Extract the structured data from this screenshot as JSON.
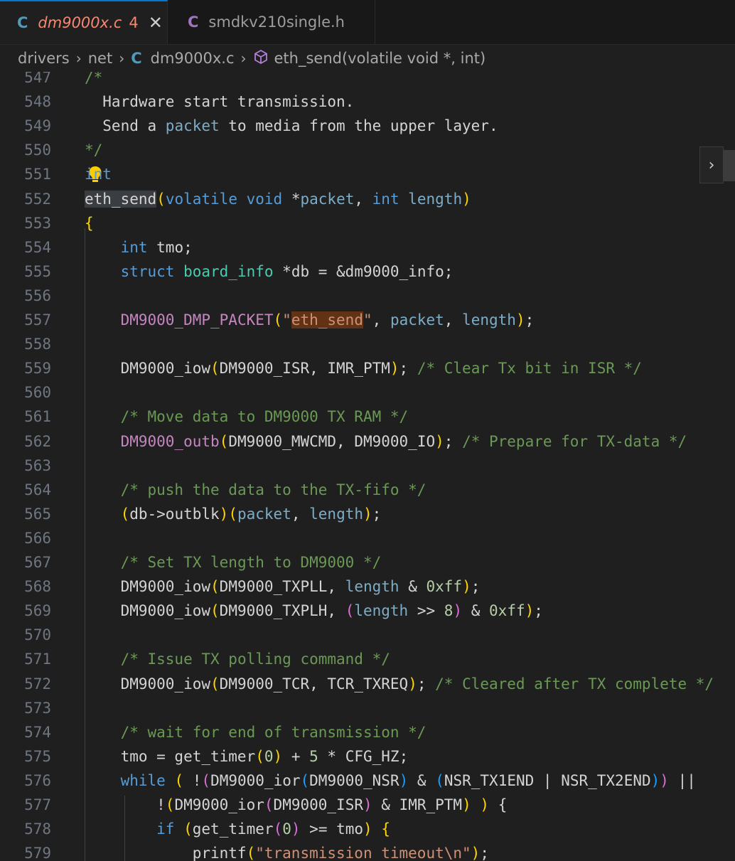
{
  "tabs": [
    {
      "icon": "C",
      "title": "dm9000x.c",
      "badge": "4",
      "close": "✕",
      "active": true
    },
    {
      "icon": "C",
      "title": "smdkv210single.h",
      "active": false
    }
  ],
  "breadcrumb": {
    "items": [
      "drivers",
      "net",
      "dm9000x.c",
      "eth_send(volatile void *, int)"
    ],
    "file_icon": "C",
    "symbol_icon": "cube-icon"
  },
  "editor": {
    "line_numbers": [
      "547",
      "548",
      "549",
      "550",
      "551",
      "552",
      "553",
      "554",
      "555",
      "556",
      "557",
      "558",
      "559",
      "560",
      "561",
      "562",
      "563",
      "564",
      "565",
      "566",
      "567",
      "568",
      "569",
      "570",
      "571",
      "572",
      "573",
      "574",
      "575",
      "576",
      "577",
      "578",
      "579"
    ],
    "lines": [
      {
        "text": "/*"
      },
      {
        "text": "  Hardware start transmission."
      },
      {
        "text": "  Send a packet to media from the upper layer."
      },
      {
        "text": "*/"
      },
      {
        "text": "int"
      },
      {
        "text": "eth_send(volatile void *packet, int length)"
      },
      {
        "text": "{"
      },
      {
        "text": "    int tmo;"
      },
      {
        "text": "    struct board_info *db = &dm9000_info;"
      },
      {
        "text": ""
      },
      {
        "text": "    DM9000_DMP_PACKET(\"eth_send\", packet, length);"
      },
      {
        "text": ""
      },
      {
        "text": "    DM9000_iow(DM9000_ISR, IMR_PTM); /* Clear Tx bit in ISR */"
      },
      {
        "text": ""
      },
      {
        "text": "    /* Move data to DM9000 TX RAM */"
      },
      {
        "text": "    DM9000_outb(DM9000_MWCMD, DM9000_IO); /* Prepare for TX-data */"
      },
      {
        "text": ""
      },
      {
        "text": "    /* push the data to the TX-fifo */"
      },
      {
        "text": "    (db->outblk)(packet, length);"
      },
      {
        "text": ""
      },
      {
        "text": "    /* Set TX length to DM9000 */"
      },
      {
        "text": "    DM9000_iow(DM9000_TXPLL, length & 0xff);"
      },
      {
        "text": "    DM9000_iow(DM9000_TXPLH, (length >> 8) & 0xff);"
      },
      {
        "text": ""
      },
      {
        "text": "    /* Issue TX polling command */"
      },
      {
        "text": "    DM9000_iow(DM9000_TCR, TCR_TXREQ); /* Cleared after TX complete */"
      },
      {
        "text": ""
      },
      {
        "text": "    /* wait for end of transmission */"
      },
      {
        "text": "    tmo = get_timer(0) + 5 * CFG_HZ;"
      },
      {
        "text": "    while ( !(DM9000_ior(DM9000_NSR) & (NSR_TX1END | NSR_TX2END)) ||"
      },
      {
        "text": "        !(DM9000_ior(DM9000_ISR) & IMR_PTM) ) {"
      },
      {
        "text": "        if (get_timer(0) >= tmo) {"
      },
      {
        "text": "            printf(\"transmission timeout\\n\");"
      }
    ]
  },
  "colors": {
    "background": "#1f1f1f",
    "comment": "#6a9955",
    "keyword": "#569cd6",
    "type": "#4ec9b0",
    "macro": "#c586c0",
    "string": "#ce9178",
    "number": "#b5cea8",
    "line_number": "#6e7681"
  },
  "icons": {
    "lightbulb": "lightbulb-icon",
    "chevron": "chevron-right-icon",
    "close": "close-icon"
  }
}
